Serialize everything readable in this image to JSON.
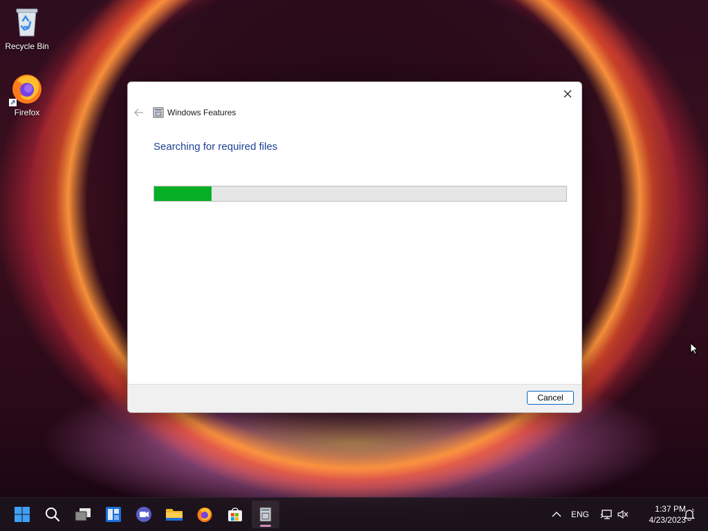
{
  "desktop": {
    "icons": [
      {
        "label": "Recycle Bin",
        "icon": "recycle-bin-icon"
      },
      {
        "label": "Firefox",
        "icon": "firefox-icon",
        "shortcut": true
      }
    ]
  },
  "dialog": {
    "title": "Windows Features",
    "heading": "Searching for required files",
    "progress_fraction": 0.14,
    "cancel_label": "Cancel",
    "colors": {
      "heading": "#1c3f94",
      "progress_fill": "#06b025",
      "button_border": "#0067c0"
    }
  },
  "taskbar": {
    "apps": [
      {
        "name": "start",
        "icon": "windows-start-icon"
      },
      {
        "name": "search",
        "icon": "search-icon"
      },
      {
        "name": "task-view",
        "icon": "task-view-icon"
      },
      {
        "name": "widgets",
        "icon": "widgets-icon"
      },
      {
        "name": "chat",
        "icon": "chat-icon"
      },
      {
        "name": "file-explorer",
        "icon": "folder-icon"
      },
      {
        "name": "firefox",
        "icon": "firefox-icon"
      },
      {
        "name": "microsoft-store",
        "icon": "store-icon"
      },
      {
        "name": "windows-features",
        "icon": "windows-features-icon",
        "active": true
      }
    ],
    "tray": {
      "language": "ENG",
      "time": "1:37 PM",
      "date": "4/23/2023"
    }
  }
}
